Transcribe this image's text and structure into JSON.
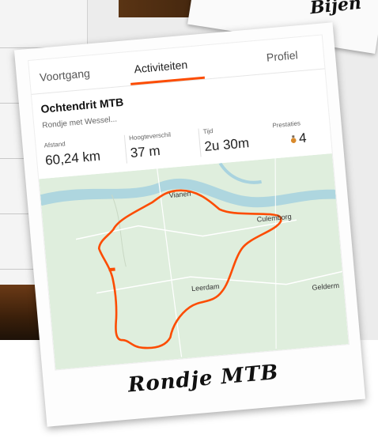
{
  "background_caption": "Bijen",
  "app": {
    "tabs": [
      {
        "label": "Voortgang",
        "active": false
      },
      {
        "label": "Activiteiten",
        "active": true
      },
      {
        "label": "Profiel",
        "active": false
      }
    ],
    "activity": {
      "title": "Ochtendrit MTB",
      "description": "Rondje met Wessel...",
      "stats": [
        {
          "label": "Afstand",
          "value": "60,24 km"
        },
        {
          "label": "Hoogteverschil",
          "value": "37 m"
        },
        {
          "label": "Tijd",
          "value": "2u 30m"
        },
        {
          "label": "Prestaties",
          "value": "4"
        }
      ]
    },
    "map": {
      "places": [
        "Vianen",
        "Culemborg",
        "Leerdam",
        "Gelderm"
      ],
      "route_color": "#fc4c02",
      "water_color": "#a9d3df",
      "land_color": "#dfeedd"
    }
  },
  "polaroid_caption": "Rondje MTB",
  "colors": {
    "accent": "#fc4c02",
    "medal": "#d98a2b"
  }
}
